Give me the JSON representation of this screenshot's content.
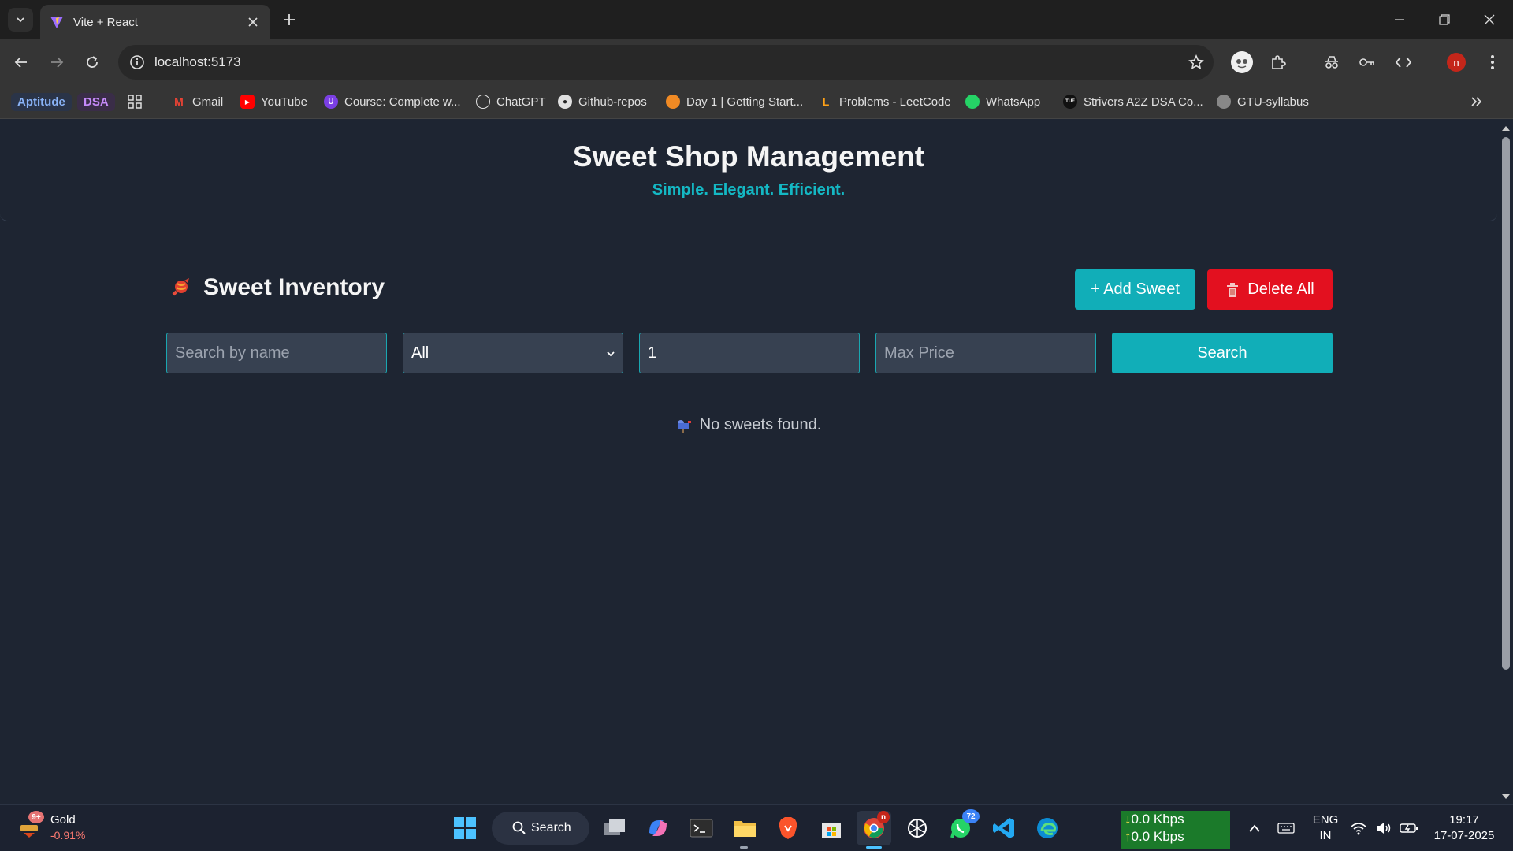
{
  "browser": {
    "tab_title": "Vite + React",
    "url": "localhost:5173",
    "profile_initial": "n"
  },
  "bookmarks": [
    {
      "label": "Aptitude",
      "color": "#8ab4f8"
    },
    {
      "label": "DSA",
      "color": "#c58af9"
    },
    {
      "label": "Gmail"
    },
    {
      "label": "YouTube"
    },
    {
      "label": "Course: Complete w..."
    },
    {
      "label": "ChatGPT"
    },
    {
      "label": "Github-repos"
    },
    {
      "label": "Day 1 | Getting Start..."
    },
    {
      "label": "Problems - LeetCode"
    },
    {
      "label": "WhatsApp"
    },
    {
      "label": "Strivers A2Z DSA Co..."
    },
    {
      "label": "GTU-syllabus"
    }
  ],
  "header": {
    "title": "Sweet Shop Management",
    "subtitle": "Simple. Elegant. Efficient."
  },
  "inventory": {
    "title": "Sweet Inventory",
    "add_label": "+ Add Sweet",
    "delete_all_label": "Delete All"
  },
  "filters": {
    "name_placeholder": "Search by name",
    "category_selected": "All",
    "min_price_value": "1",
    "max_price_placeholder": "Max Price",
    "search_label": "Search"
  },
  "empty_message": "No sweets found.",
  "taskbar": {
    "widget_title": "Gold",
    "widget_change": "-0.91%",
    "widget_badge": "9+",
    "search_label": "Search",
    "whatsapp_badge": "72",
    "chrome_badge": "n",
    "net_down": "0.0 Kbps",
    "net_up": "0.0 Kbps",
    "lang_top": "ENG",
    "lang_bottom": "IN",
    "time": "19:17",
    "date": "17-07-2025"
  },
  "colors": {
    "accent": "#11aeb8",
    "danger": "#e3101f",
    "background": "#1e2532",
    "field": "#374151"
  }
}
